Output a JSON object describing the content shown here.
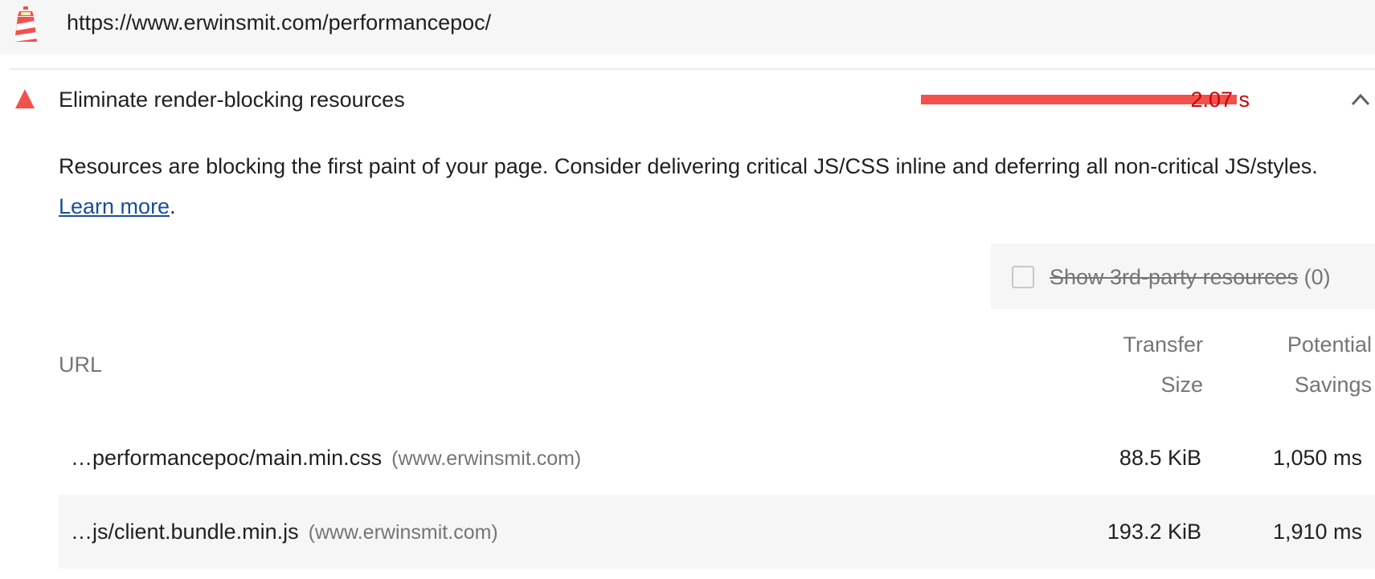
{
  "header": {
    "url": "https://www.erwinsmit.com/performancepoc/",
    "logo_icon": "lighthouse-icon"
  },
  "audit": {
    "status_icon": "fail-triangle-icon",
    "title": "Eliminate render-blocking resources",
    "sparkline_fraction": 1.0,
    "display_value": "2.07 s",
    "toggle_icon": "chevron-up-icon",
    "description_prefix": "Resources are blocking the first paint of your page. Consider delivering critical JS/CSS inline and deferring all non-critical JS/styles. ",
    "learn_more": "Learn more",
    "description_suffix": ".",
    "colors": {
      "fail": "#f4504c",
      "fail_text": "#cc0000",
      "link": "#1a4d9c"
    }
  },
  "third_party": {
    "label": "Show 3rd-party resources",
    "count": "(0)",
    "checked": false
  },
  "table": {
    "headers": {
      "url": "URL",
      "transfer_size_line1": "Transfer",
      "transfer_size_line2": "Size",
      "savings_line1": "Potential",
      "savings_line2": "Savings"
    },
    "rows": [
      {
        "url": "…performancepoc/main.min.css",
        "origin": "(www.erwinsmit.com)",
        "transfer_size": "88.5 KiB",
        "savings": "1,050 ms"
      },
      {
        "url": "…js/client.bundle.min.js",
        "origin": "(www.erwinsmit.com)",
        "transfer_size": "193.2 KiB",
        "savings": "1,910 ms"
      }
    ]
  }
}
